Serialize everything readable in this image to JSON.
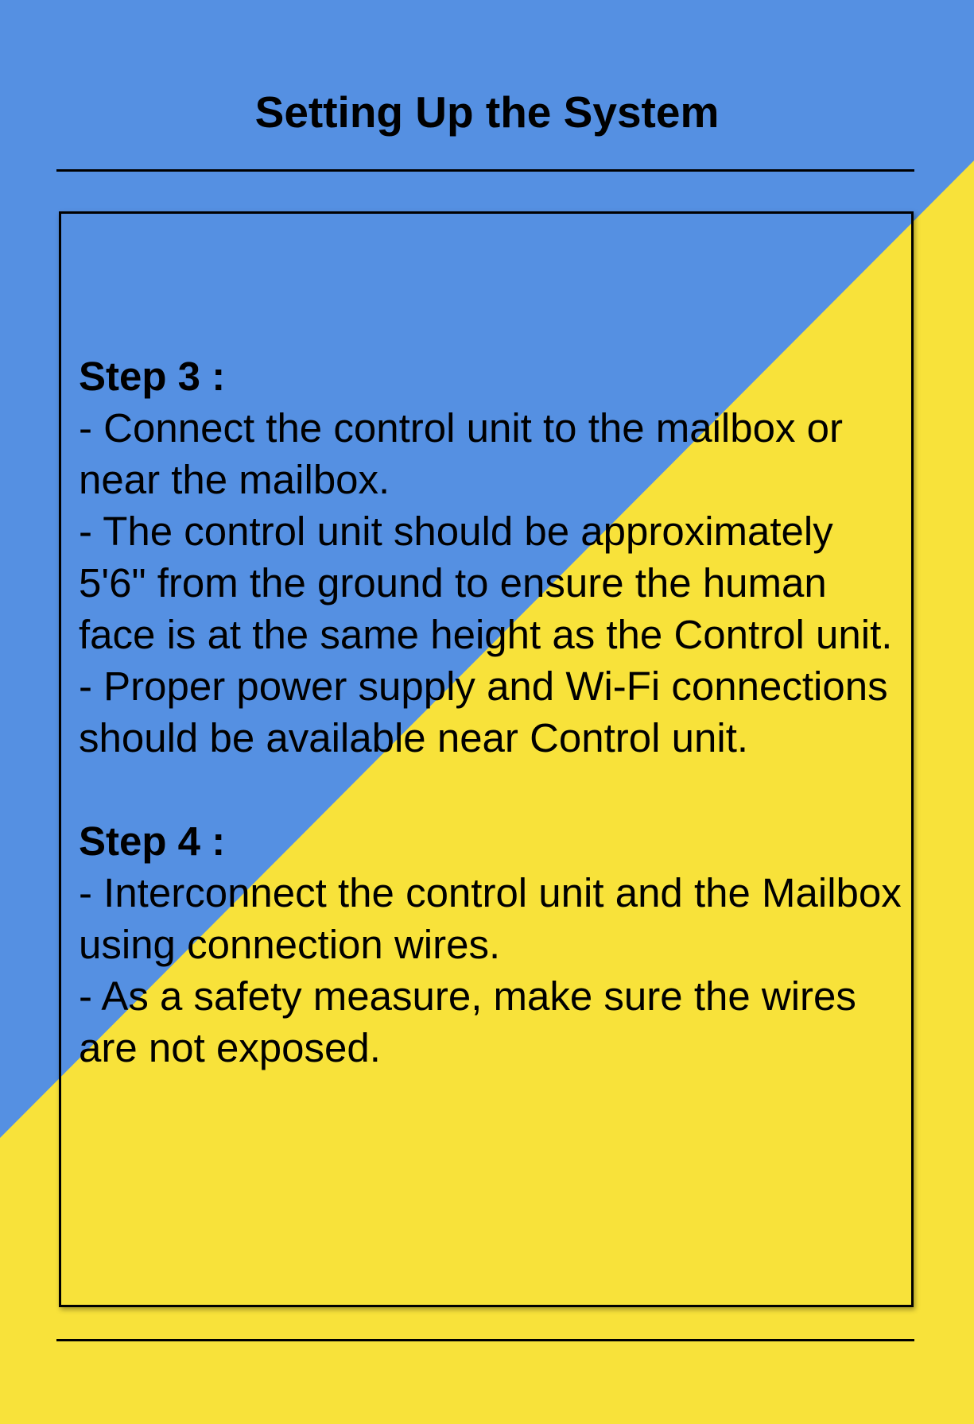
{
  "title": "Setting Up the System",
  "colors": {
    "background_blue": "#5590E2",
    "background_yellow": "#F8E23A",
    "text": "#000000"
  },
  "steps": [
    {
      "heading": "Step 3 :",
      "lines": [
        "- Connect the control unit to the mailbox or near the mailbox.",
        "- The control unit should be approximately 5'6\" from the ground to ensure the human face is at the same height as the Control unit.",
        "- Proper power supply and Wi-Fi connections should be available near Control unit."
      ]
    },
    {
      "heading": "Step 4 :",
      "lines": [
        "- Interconnect the control unit and the Mailbox using connection wires.",
        "- As a safety measure, make sure the wires are not exposed."
      ]
    }
  ]
}
